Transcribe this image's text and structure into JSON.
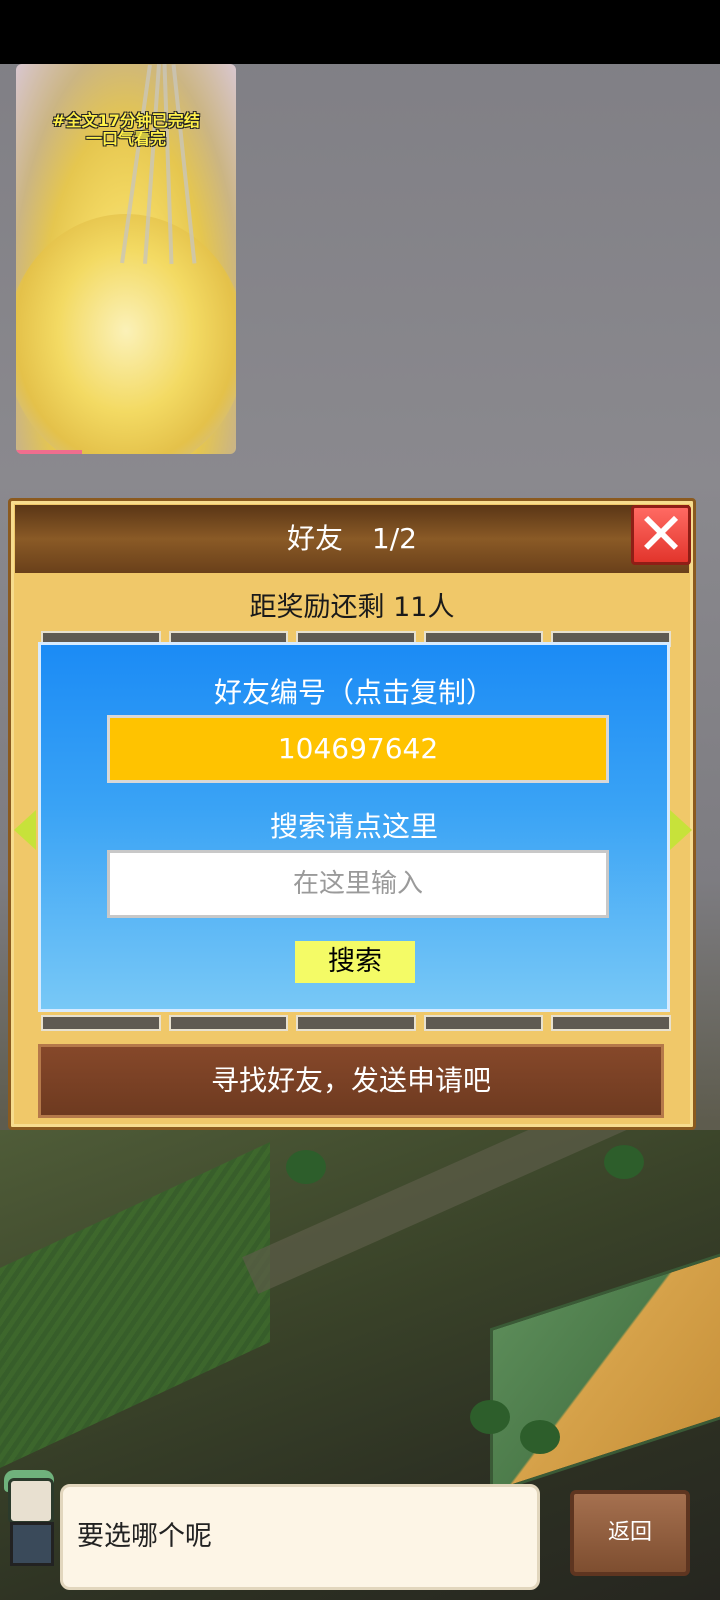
{
  "video": {
    "caption_line1": "#全文17分钟已完结",
    "caption_line2": "一口气看完",
    "progress_fraction": 0.3
  },
  "panel": {
    "title": "好友",
    "page": "1/2",
    "close_glyph": "✕",
    "reward_text": "距奖励还剩 11人",
    "find_friends_text": "寻找好友，发送申请吧"
  },
  "dialog": {
    "friend_id_label": "好友编号（点击复制）",
    "friend_id": "104697642",
    "search_label": "搜索请点这里",
    "search_placeholder": "在这里输入",
    "search_value": "",
    "search_button": "搜索"
  },
  "bottom": {
    "speech_text": "要选哪个呢",
    "back_button": "返回"
  },
  "colors": {
    "dialog_blue": "#1b8bf5",
    "id_box_yellow": "#ffc300",
    "search_button_yellow": "#f4fb66",
    "close_red": "#e2352c",
    "panel_gold": "#f0c869"
  },
  "icons": {
    "close": "close-icon",
    "left_arrow": "arrow-left-icon",
    "right_arrow": "arrow-right-icon"
  }
}
